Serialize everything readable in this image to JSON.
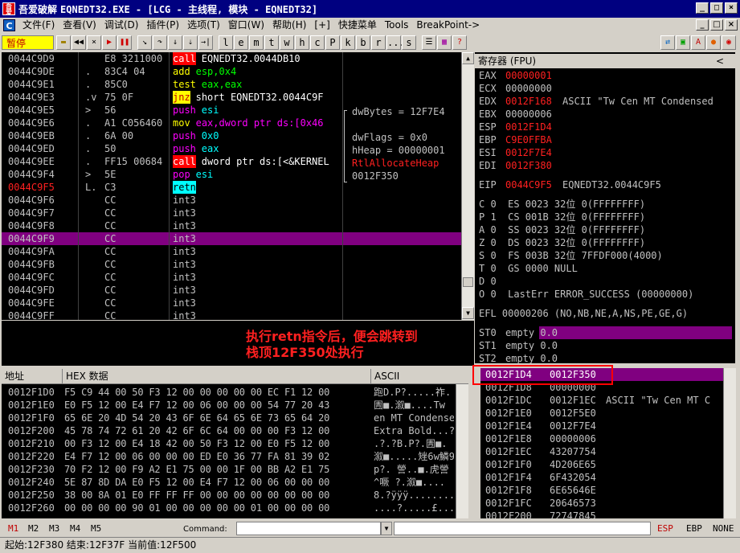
{
  "window": {
    "app_name": "吾爱破解",
    "title": "EQNEDT32.EXE - [LCG - 主线程, 模块 - EQNEDT32]",
    "logo_text": "吾爱"
  },
  "menu": [
    "文件(F)",
    "查看(V)",
    "调试(D)",
    "插件(P)",
    "选项(T)",
    "窗口(W)",
    "帮助(H)",
    "[+]",
    "快捷菜单",
    "Tools",
    "BreakPoint->"
  ],
  "toolbar": {
    "status": "暂停",
    "letters": [
      "l",
      "e",
      "m",
      "t",
      "w",
      "h",
      "c",
      "P",
      "k",
      "b",
      "r",
      "...",
      "s"
    ]
  },
  "disasm": [
    {
      "addr": "0044C9D9",
      "mark": " ",
      "hex": "E8 3211000",
      "mnem": "call",
      "ops": "EQNEDT32.0044DB10",
      "type": "call"
    },
    {
      "addr": "0044C9DE",
      "mark": ".",
      "hex": "83C4 04",
      "mnem": "add",
      "ops": "esp,0x4",
      "type": "normal"
    },
    {
      "addr": "0044C9E1",
      "mark": ".",
      "hex": "85C0",
      "mnem": "test",
      "ops": "eax,eax",
      "type": "normal"
    },
    {
      "addr": "0044C9E3",
      "mark": ".v",
      "hex": "75 0F",
      "mnem": "jnz",
      "ops": "short EQNEDT32.0044C9F",
      "type": "jump"
    },
    {
      "addr": "0044C9E5",
      "mark": ">",
      "hex": "56",
      "mnem": "push",
      "ops": "esi",
      "type": "push"
    },
    {
      "addr": "0044C9E6",
      "mark": ".",
      "hex": "A1 C056460",
      "mnem": "mov",
      "ops": "eax,dword ptr ds:[0x46",
      "type": "normal"
    },
    {
      "addr": "0044C9EB",
      "mark": ".",
      "hex": "6A 00",
      "mnem": "push",
      "ops": "0x0",
      "type": "push"
    },
    {
      "addr": "0044C9ED",
      "mark": ".",
      "hex": "50",
      "mnem": "push",
      "ops": "eax",
      "type": "push"
    },
    {
      "addr": "0044C9EE",
      "mark": ".",
      "hex": "FF15 00684",
      "mnem": "call",
      "ops": "dword ptr ds:[<&KERNEL",
      "type": "call"
    },
    {
      "addr": "0044C9F4",
      "mark": ">",
      "hex": "5E",
      "mnem": "pop",
      "ops": "esi",
      "type": "push"
    },
    {
      "addr": "0044C9F5",
      "mark": "L.",
      "hex": "C3",
      "mnem": "retn",
      "ops": "",
      "type": "retn"
    },
    {
      "addr": "0044C9F6",
      "mark": " ",
      "hex": "CC",
      "mnem": "int3",
      "ops": "",
      "type": "int3"
    },
    {
      "addr": "0044C9F7",
      "mark": " ",
      "hex": "CC",
      "mnem": "int3",
      "ops": "",
      "type": "int3"
    },
    {
      "addr": "0044C9F8",
      "mark": " ",
      "hex": "CC",
      "mnem": "int3",
      "ops": "",
      "type": "int3"
    },
    {
      "addr": "0044C9F9",
      "mark": " ",
      "hex": "CC",
      "mnem": "int3",
      "ops": "",
      "type": "int3"
    },
    {
      "addr": "0044C9FA",
      "mark": " ",
      "hex": "CC",
      "mnem": "int3",
      "ops": "",
      "type": "int3"
    },
    {
      "addr": "0044C9FB",
      "mark": " ",
      "hex": "CC",
      "mnem": "int3",
      "ops": "",
      "type": "int3"
    },
    {
      "addr": "0044C9FC",
      "mark": " ",
      "hex": "CC",
      "mnem": "int3",
      "ops": "",
      "type": "int3"
    },
    {
      "addr": "0044C9FD",
      "mark": " ",
      "hex": "CC",
      "mnem": "int3",
      "ops": "",
      "type": "int3"
    },
    {
      "addr": "0044C9FE",
      "mark": " ",
      "hex": "CC",
      "mnem": "int3",
      "ops": "",
      "type": "int3"
    },
    {
      "addr": "0044C9FF",
      "mark": " ",
      "hex": "CC",
      "mnem": "int3",
      "ops": "",
      "type": "int3"
    }
  ],
  "comments": {
    "dwBytes": "dwBytes = 12F7E4",
    "dwFlags": "dwFlags = 0x0",
    "hHeap": "hHeap = 00000001",
    "api": "RtlAllocateHeap",
    "retaddr": "0012F350"
  },
  "registers": {
    "header": "寄存器 (FPU)",
    "gp": [
      {
        "name": "EAX",
        "value": "00000001",
        "changed": true,
        "note": ""
      },
      {
        "name": "ECX",
        "value": "00000000",
        "changed": false,
        "note": ""
      },
      {
        "name": "EDX",
        "value": "0012F168",
        "changed": true,
        "note": "ASCII \"Tw Cen MT Condensed"
      },
      {
        "name": "EBX",
        "value": "00000006",
        "changed": false,
        "note": ""
      },
      {
        "name": "ESP",
        "value": "0012F1D4",
        "changed": true,
        "note": ""
      },
      {
        "name": "EBP",
        "value": "C9E0FFBA",
        "changed": true,
        "note": ""
      },
      {
        "name": "ESI",
        "value": "0012F7E4",
        "changed": true,
        "note": ""
      },
      {
        "name": "EDI",
        "value": "0012F380",
        "changed": true,
        "note": ""
      }
    ],
    "eip": {
      "name": "EIP",
      "value": "0044C9F5",
      "note": "EQNEDT32.0044C9F5"
    },
    "segs": [
      "C 0  ES 0023 32位 0(FFFFFFFF)",
      "P 1  CS 001B 32位 0(FFFFFFFF)",
      "A 0  SS 0023 32位 0(FFFFFFFF)",
      "Z 0  DS 0023 32位 0(FFFFFFFF)",
      "S 0  FS 003B 32位 7FFDF000(4000)",
      "T 0  GS 0000 NULL",
      "D 0",
      "O 0  LastErr ERROR_SUCCESS (00000000)"
    ],
    "efl": "EFL 00000206 (NO,NB,NE,A,NS,PE,GE,G)",
    "fpu": [
      {
        "name": "ST0",
        "text": "empty 0.0"
      },
      {
        "name": "ST1",
        "text": "empty 0.0"
      },
      {
        "name": "ST2",
        "text": "empty 0.0"
      }
    ]
  },
  "annotation": {
    "line1": "执行retn指令后，便会跳转到",
    "line2": "栈顶12F350处执行"
  },
  "dump": {
    "col_addr": "地址",
    "col_hex": "HEX 数据",
    "col_ascii": "ASCII",
    "rows": [
      {
        "addr": "0012F1D0",
        "hex": "F5 C9 44 00 50 F3 12 00 00 00 00 00 EC F1 12 00",
        "ascii": "跑D.P?.....祚."
      },
      {
        "addr": "0012F1E0",
        "hex": "E0 F5 12 00 E4 F7 12 00 06 00 00 00 54 77 20 43",
        "ascii": "圊■.溆■....Tw"
      },
      {
        "addr": "0012F1F0",
        "hex": "65 6E 20 4D 54 20 43 6F 6E 64 65 6E 73 65 64 20",
        "ascii": "en MT Condensed"
      },
      {
        "addr": "0012F200",
        "hex": "45 78 74 72 61 20 42 6F 6C 64 00 00 00 F3 12 00",
        "ascii": "Extra Bold...?"
      },
      {
        "addr": "0012F210",
        "hex": "00 F3 12 00 E4 18 42 00 50 F3 12 00 E0 F5 12 00",
        "ascii": ".?.?B.P?.圊■."
      },
      {
        "addr": "0012F220",
        "hex": "E4 F7 12 00 06 00 00 00 ED E0 36 77 FA 81 39 02",
        "ascii": "溆■.....矬6w鱗9"
      },
      {
        "addr": "0012F230",
        "hex": "70 F2 12 00 F9 A2 E1 75 00 00 1F 00 BB A2 E1 75",
        "ascii": "p?.  謍..■.虎謍"
      },
      {
        "addr": "0012F240",
        "hex": "5E 87 8D DA E0 F5 12 00 E4 F7 12 00 06 00 00 00",
        "ascii": "^噘 ?.溆■...."
      },
      {
        "addr": "0012F250",
        "hex": "38 00 8A 01 E0 FF FF FF 00 00 00 00 00 00 00 00",
        "ascii": "8.?ÿÿÿ........"
      },
      {
        "addr": "0012F260",
        "hex": "00 00 00 00 90 01 00 00 00 00 00 01 00 00 00 00",
        "ascii": "....?.....£...."
      }
    ]
  },
  "stack": [
    {
      "addr": "0012F1D4",
      "value": "0012F350",
      "note": ""
    },
    {
      "addr": "0012F1D8",
      "value": "00000000",
      "note": ""
    },
    {
      "addr": "0012F1DC",
      "value": "0012F1EC",
      "note": "ASCII \"Tw Cen MT C"
    },
    {
      "addr": "0012F1E0",
      "value": "0012F5E0",
      "note": ""
    },
    {
      "addr": "0012F1E4",
      "value": "0012F7E4",
      "note": ""
    },
    {
      "addr": "0012F1E8",
      "value": "00000006",
      "note": ""
    },
    {
      "addr": "0012F1EC",
      "value": "43207754",
      "note": ""
    },
    {
      "addr": "0012F1F0",
      "value": "4D206E65",
      "note": ""
    },
    {
      "addr": "0012F1F4",
      "value": "6F432054",
      "note": ""
    },
    {
      "addr": "0012F1F8",
      "value": "6E65646E",
      "note": ""
    },
    {
      "addr": "0012F1FC",
      "value": "20646573",
      "note": ""
    },
    {
      "addr": "0012F200",
      "value": "72747845",
      "note": ""
    }
  ],
  "bottom": {
    "tabs": [
      "M1",
      "M2",
      "M3",
      "M4",
      "M5"
    ],
    "command_label": "Command:",
    "command_value": "",
    "stack_modes": [
      "ESP",
      "EBP",
      "NONE"
    ]
  },
  "status": "起始:12F380 结束:12F37F 当前值:12F500",
  "colors": {
    "call_bg": "#ff0000",
    "jump_bg": "#ffff00",
    "retn_bg": "#00ffff",
    "push": "#ff00ff",
    "changed": "#ff2020",
    "highlight": "#800080"
  }
}
